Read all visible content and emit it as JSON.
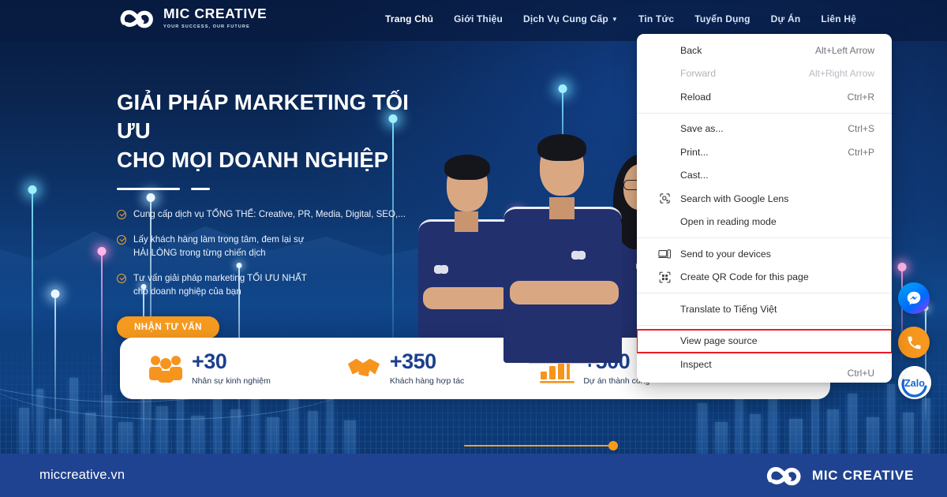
{
  "site": {
    "brand_name": "MIC CREATIVE",
    "brand_tagline": "YOUR SUCCESS, OUR FUTURE",
    "url": "miccreative.vn",
    "footer_brand": "MIC CREATIVE",
    "colors": {
      "brand_navy": "#1f4391",
      "accent_orange": "#f59a1f",
      "hero_dark": "#071a3d",
      "stat_number": "#1b3f8f",
      "highlight_red": "#ee1c24"
    }
  },
  "nav": {
    "items": [
      {
        "label": "Trang Chủ",
        "active": true,
        "has_caret": false
      },
      {
        "label": "Giới Thiệu",
        "active": false,
        "has_caret": false
      },
      {
        "label": "Dịch Vụ Cung Cấp",
        "active": false,
        "has_caret": true
      },
      {
        "label": "Tin Tức",
        "active": false,
        "has_caret": false
      },
      {
        "label": "Tuyển Dụng",
        "active": false,
        "has_caret": false
      },
      {
        "label": "Dự Án",
        "active": false,
        "has_caret": false
      },
      {
        "label": "Liên Hệ",
        "active": false,
        "has_caret": false
      }
    ]
  },
  "hero": {
    "headline_line1": "GIẢI PHÁP MARKETING TỐI ƯU",
    "headline_line2": "CHO MỌI DOANH NGHIỆP",
    "bullets": [
      {
        "text": "Cung cấp dịch vụ TỔNG THỂ: Creative, PR, Media, Digital, SEO,..."
      },
      {
        "text": "Lấy khách hàng làm trọng tâm, đem lại sự\nHÀI LÒNG trong từng chiến dịch"
      },
      {
        "text": "Tư vấn giải pháp marketing TỐI ƯU NHẤT\ncho doanh nghiệp của bạn"
      }
    ],
    "cta_label": "NHẬN TƯ VẤN"
  },
  "stats": [
    {
      "icon": "people-icon",
      "number": "+30",
      "label": "Nhân sự kinh nghiệm"
    },
    {
      "icon": "handshake-icon",
      "number": "+350",
      "label": "Khách hàng hợp tác"
    },
    {
      "icon": "growth-chart-icon",
      "number": "+500",
      "label": "Dự án thành công"
    },
    {
      "icon": "thumbs-up-icon",
      "number": "",
      "label": ""
    }
  ],
  "slider": {
    "position_percent": 100
  },
  "float_buttons": [
    {
      "name": "messenger-button",
      "label": "Messenger"
    },
    {
      "name": "phone-call-button",
      "label": "Phone"
    },
    {
      "name": "zalo-button",
      "label": "Zalo"
    }
  ],
  "context_menu": {
    "groups": [
      {
        "items": [
          {
            "label": "Back",
            "accel": "Alt+Left Arrow",
            "icon": null,
            "disabled": false,
            "highlighted": false
          },
          {
            "label": "Forward",
            "accel": "Alt+Right Arrow",
            "icon": null,
            "disabled": true,
            "highlighted": false
          },
          {
            "label": "Reload",
            "accel": "Ctrl+R",
            "icon": null,
            "disabled": false,
            "highlighted": false
          }
        ]
      },
      {
        "items": [
          {
            "label": "Save as...",
            "accel": "Ctrl+S",
            "icon": null,
            "disabled": false,
            "highlighted": false
          },
          {
            "label": "Print...",
            "accel": "Ctrl+P",
            "icon": null,
            "disabled": false,
            "highlighted": false
          },
          {
            "label": "Cast...",
            "accel": "",
            "icon": null,
            "disabled": false,
            "highlighted": false
          },
          {
            "label": "Search with Google Lens",
            "accel": "",
            "icon": "google-lens-icon",
            "disabled": false,
            "highlighted": false
          },
          {
            "label": "Open in reading mode",
            "accel": "",
            "icon": null,
            "disabled": false,
            "highlighted": false
          }
        ]
      },
      {
        "items": [
          {
            "label": "Send to your devices",
            "accel": "",
            "icon": "send-to-devices-icon",
            "disabled": false,
            "highlighted": false
          },
          {
            "label": "Create QR Code for this page",
            "accel": "",
            "icon": "qr-code-icon",
            "disabled": false,
            "highlighted": false
          }
        ]
      },
      {
        "items": [
          {
            "label": "Translate to Tiếng Việt",
            "accel": "",
            "icon": null,
            "disabled": false,
            "highlighted": false
          }
        ]
      },
      {
        "items": [
          {
            "label": "View page source",
            "accel": "Ctrl+U",
            "icon": null,
            "disabled": false,
            "highlighted": true
          },
          {
            "label": "Inspect",
            "accel": "",
            "icon": null,
            "disabled": false,
            "highlighted": false
          }
        ]
      }
    ]
  }
}
